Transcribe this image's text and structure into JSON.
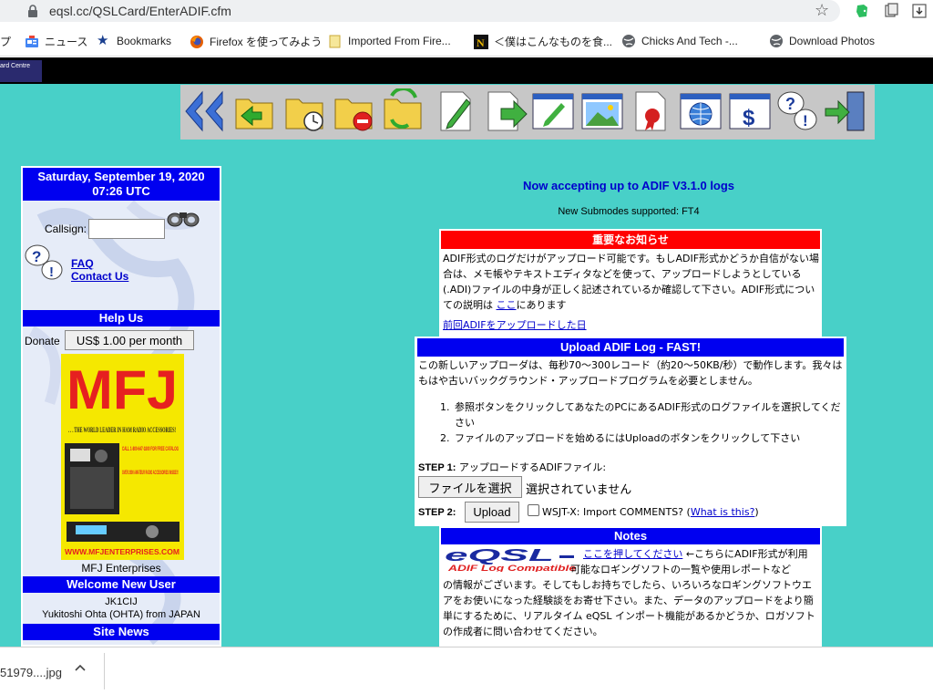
{
  "browser": {
    "url": "eqsl.cc/QSLCard/EnterADIF.cfm",
    "bookmarks": [
      {
        "label": "プ",
        "icon": "apps-icon"
      },
      {
        "label": "ニュース",
        "icon": "news-icon"
      },
      {
        "label": "Bookmarks",
        "icon": "star-icon"
      },
      {
        "label": "Firefox を使ってみよう",
        "icon": "firefox-icon"
      },
      {
        "label": "Imported From Fire...",
        "icon": "folder-icon"
      },
      {
        "label": "＜僕はこんなものを食...",
        "icon": "n-icon"
      },
      {
        "label": "Chicks And Tech -...",
        "icon": "globe-icon"
      },
      {
        "label": "Download Photos",
        "icon": "globe-icon"
      }
    ]
  },
  "site": {
    "card_centre_label": "ard Centre"
  },
  "sidebar": {
    "date": "Saturday, September 19, 2020 07:26 UTC",
    "callsign_label": "Callsign:",
    "faq_label": "FAQ",
    "contact_label": "Contact Us",
    "help_us_title": "Help Us",
    "donate_label": "Donate",
    "donate_button": "US$ 1.00 per month",
    "ad": {
      "logo": "MFJ",
      "tagline": ". . . THE WORLD LEADER IN HAM RADIO ACCESSORIES!",
      "call": "CALL 1-800-647-1800 FOR FREE CATALOG",
      "over": "OVER 2000 AMATEUR RADIO ACCESSORIES INSIDE!!!",
      "url": "WWW.MFJENTERPRISES.COM"
    },
    "ad_caption": "MFJ Enterprises",
    "welcome_title": "Welcome New User",
    "new_user_call": "JK1CIJ",
    "new_user_name": "Yukitoshi Ohta (OHTA) from JAPAN",
    "site_news_title": "Site News"
  },
  "main": {
    "accepting": "Now accepting up to ADIF V3.1.0 logs",
    "submodes": "New Submodes supported: FT4",
    "notice": {
      "title": "重要なお知らせ",
      "body_before_link": "ADIF形式のログだけがアップロード可能です。もしADIF形式かどうか自信がない場合は、メモ帳やテキストエディタなどを使って、アップロードしようとしている(.ADI)ファイルの中身が正しく記述されているか確認して下さい。ADIF形式についての説明は ",
      "body_link": "ここ",
      "body_after_link": "にあります",
      "previous_upload_link": "前回ADIFをアップロードした日"
    },
    "upload": {
      "title": "Upload ADIF Log - FAST!",
      "description": "この新しいアップローダは、毎秒70～300レコード（約20～50KB/秒）で動作します。我々はもはや古いバックグラウンド・アップロードプログラムを必要としません。",
      "steps": [
        {
          "num": "1.",
          "text": "参照ボタンをクリックしてあなたのPCにあるADIF形式のログファイルを選択してください"
        },
        {
          "num": "2.",
          "text": "ファイルのアップロードを始めるにはUploadのボタンをクリックして下さい"
        }
      ],
      "step1_label": "STEP 1:",
      "step1_text": " アップロードするADIFファイル:",
      "file_button": "ファイルを選択",
      "file_status": "選択されていません",
      "step2_label": "STEP 2:",
      "upload_button": "Upload",
      "wsjt_label": "WSJT-X: Import COMMENTS? (",
      "wsjt_link": "What is this?",
      "wsjt_close": ")"
    },
    "notes": {
      "title": "Notes",
      "logo_text": "eQSL",
      "logo_sub": "ADIF Log Compatible",
      "link": "ここを押してください",
      "line1_rest": " ←こちらにADIF形式が利用",
      "line2": "可能なロギングソフトの一覧や使用レポートなど",
      "body": "の情報がございます。そしてもしお持ちでしたら、いろいろなロギングソフトウエアをお使いになった経験談をお寄せ下さい。また、データのアップロードをより簡単にするために、リアルタイム eQSL インポート機能があるかどうか、ロガソフトの作成者に問い合わせてください。"
    }
  },
  "download": {
    "filename": "51979....jpg"
  },
  "colors": {
    "page_bg": "#48d0c8",
    "header_blue": "#0000f0",
    "notice_red": "#ff0000",
    "link_blue": "#0000cc"
  }
}
